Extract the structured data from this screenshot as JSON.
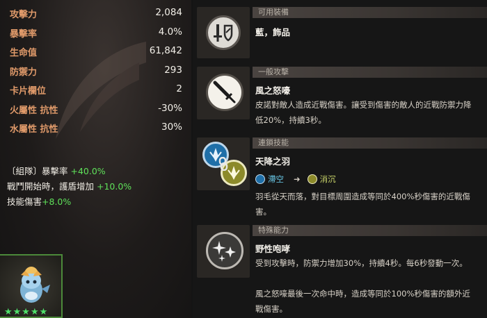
{
  "stats": [
    {
      "label": "攻擊力",
      "value": "2,084"
    },
    {
      "label": "暴擊率",
      "value": "4.0%"
    },
    {
      "label": "生命值",
      "value": "61,842"
    },
    {
      "label": "防禦力",
      "value": "293"
    },
    {
      "label": "卡片欄位",
      "value": "2"
    },
    {
      "label": "火屬性 抗性",
      "value": "-30%"
    },
    {
      "label": "水屬性 抗性",
      "value": "30%"
    }
  ],
  "bonuses": [
    {
      "label": "〔組隊〕暴擊率 ",
      "value": "+40.0%"
    },
    {
      "label": "戰鬥開始時，護盾增加 ",
      "value": "+10.0%"
    },
    {
      "label": "技能傷害",
      "value": "+8.0%"
    }
  ],
  "card": {
    "stars": "★★★★★",
    "star_color": "#4fe06a",
    "border_color": "#4c8a3a"
  },
  "equip": {
    "header": "可用裝備",
    "value": "藍，飾品",
    "icon": "sword-shield-icon"
  },
  "attack": {
    "header": "一般攻擊",
    "title": "風之怒嚎",
    "desc": "皮諾對敵人造成近戰傷害。讓受到傷害的敵人的近戰防禦力降低20%，持續3秒。",
    "icon": "sword-icon"
  },
  "chain": {
    "header": "連鎖技能",
    "title": "天降之羽",
    "element1": "滯空",
    "element2": "消沉",
    "desc": "羽毛從天而落，對目標周圍造成等同於400%秒傷害的近戰傷害。",
    "icon": "feather-chain-icon"
  },
  "special": {
    "header": "特殊能力",
    "title": "野性咆哮",
    "desc1": "受到攻擊時，防禦力增加30%，持續4秒。每6秒發動一次。",
    "desc2": "風之怒嚎最後一次命中時，造成等同於100%秒傷害的額外近戰傷害。",
    "icon": "sparkle-icon"
  },
  "colors": {
    "stat_label": "#e09a6a",
    "bonus_green": "#5fe15a",
    "element_blue": "#69c9e8",
    "element_yellow": "#c9d46a"
  }
}
